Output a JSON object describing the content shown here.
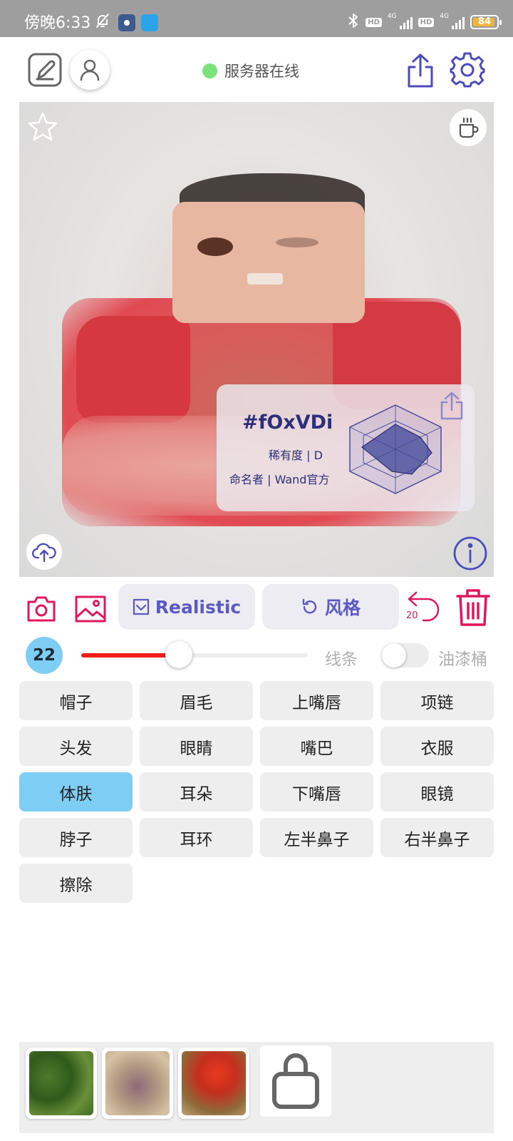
{
  "status_bar": {
    "time": "傍晚6:33",
    "hd_label": "HD",
    "network_label": "4G",
    "battery": "84",
    "battery_color": "#f0b43a"
  },
  "header": {
    "server_status": "服务器在线",
    "server_status_color": "#79e37a",
    "icons": [
      "edit-icon",
      "profile-icon",
      "share-icon",
      "gear-icon"
    ]
  },
  "image": {
    "icons": [
      "star-icon",
      "coffee-cup-icon",
      "cloud-upload-icon",
      "info-icon"
    ],
    "card": {
      "tag": "#fOxVDi",
      "rarity": "稀有度 | D",
      "author": "命名者 | Wand官方"
    }
  },
  "toolbar": {
    "realistic_label": "Realistic",
    "style_label": "风格",
    "undo_count": "20",
    "accent_color": "#e0175c",
    "button_text_color": "#5b59c4"
  },
  "brush": {
    "size": "22",
    "slider_fraction": 0.43,
    "line_label": "线条",
    "bucket_label": "油漆桶",
    "bucket_enabled": false
  },
  "parts": [
    {
      "label": "帽子",
      "active": false
    },
    {
      "label": "眉毛",
      "active": false
    },
    {
      "label": "上嘴唇",
      "active": false
    },
    {
      "label": "项链",
      "active": false
    },
    {
      "label": "头发",
      "active": false
    },
    {
      "label": "眼睛",
      "active": false
    },
    {
      "label": "嘴巴",
      "active": false
    },
    {
      "label": "衣服",
      "active": false
    },
    {
      "label": "体肤",
      "active": true
    },
    {
      "label": "耳朵",
      "active": false
    },
    {
      "label": "下嘴唇",
      "active": false
    },
    {
      "label": "眼镜",
      "active": false
    },
    {
      "label": "脖子",
      "active": false
    },
    {
      "label": "耳环",
      "active": false
    },
    {
      "label": "左半鼻子",
      "active": false
    },
    {
      "label": "右半鼻子",
      "active": false
    },
    {
      "label": "擦除",
      "active": false
    }
  ],
  "bottom_bar": {
    "thumbnails": 3,
    "shop_icon": "shopping-bag-icon"
  }
}
